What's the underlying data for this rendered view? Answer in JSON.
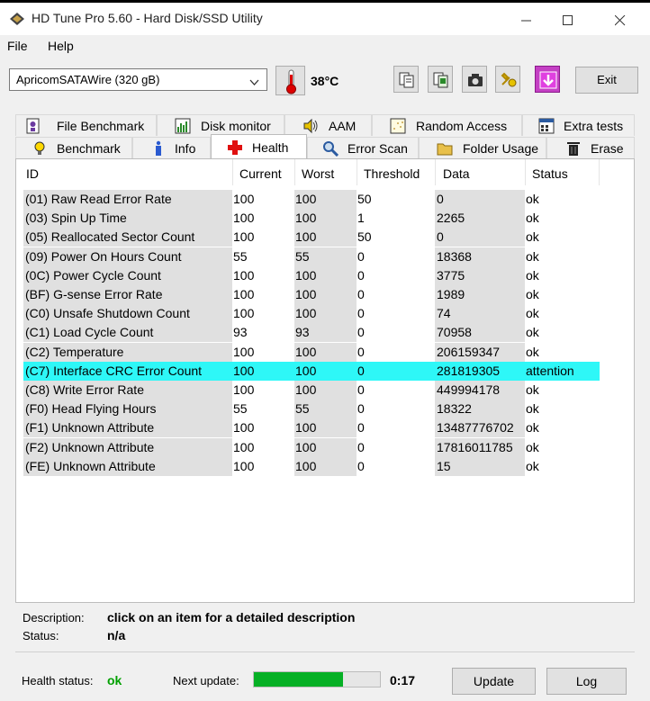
{
  "window": {
    "title": "HD Tune Pro 5.60 - Hard Disk/SSD Utility"
  },
  "menu": {
    "file": "File",
    "help": "Help"
  },
  "toolbar": {
    "drive": "ApricomSATAWire (320 gB)",
    "temperature": "38°C",
    "exit_label": "Exit"
  },
  "tabs_top": [
    {
      "label": "File Benchmark",
      "icon": "file-benchmark-icon"
    },
    {
      "label": "Disk monitor",
      "icon": "disk-monitor-icon"
    },
    {
      "label": "AAM",
      "icon": "speaker-icon"
    },
    {
      "label": "Random Access",
      "icon": "random-access-icon"
    },
    {
      "label": "Extra tests",
      "icon": "extra-tests-icon"
    }
  ],
  "tabs_bottom": [
    {
      "label": "Benchmark",
      "icon": "lightbulb-icon"
    },
    {
      "label": "Info",
      "icon": "info-icon"
    },
    {
      "label": "Health",
      "icon": "health-cross-icon"
    },
    {
      "label": "Error Scan",
      "icon": "magnifier-icon"
    },
    {
      "label": "Folder Usage",
      "icon": "folder-icon"
    },
    {
      "label": "Erase",
      "icon": "trash-icon"
    }
  ],
  "table": {
    "columns": [
      "ID",
      "Current",
      "Worst",
      "Threshold",
      "Data",
      "Status"
    ],
    "rows": [
      [
        "(01) Raw Read Error Rate",
        "100",
        "100",
        "50",
        "0",
        "ok"
      ],
      [
        "(03) Spin Up Time",
        "100",
        "100",
        "1",
        "2265",
        "ok"
      ],
      [
        "(05) Reallocated Sector Count",
        "100",
        "100",
        "50",
        "0",
        "ok"
      ],
      [
        "(09) Power On Hours Count",
        "55",
        "55",
        "0",
        "18368",
        "ok"
      ],
      [
        "(0C) Power Cycle Count",
        "100",
        "100",
        "0",
        "3775",
        "ok"
      ],
      [
        "(BF) G-sense Error Rate",
        "100",
        "100",
        "0",
        "1989",
        "ok"
      ],
      [
        "(C0) Unsafe Shutdown Count",
        "100",
        "100",
        "0",
        "74",
        "ok"
      ],
      [
        "(C1) Load Cycle Count",
        "93",
        "93",
        "0",
        "70958",
        "ok"
      ],
      [
        "(C2) Temperature",
        "100",
        "100",
        "0",
        "206159347",
        "ok"
      ],
      [
        "(C7) Interface CRC Error Count",
        "100",
        "100",
        "0",
        "281819305",
        "attention"
      ],
      [
        "(C8) Write Error Rate",
        "100",
        "100",
        "0",
        "449994178",
        "ok"
      ],
      [
        "(F0) Head Flying Hours",
        "55",
        "55",
        "0",
        "18322",
        "ok"
      ],
      [
        "(F1) Unknown Attribute",
        "100",
        "100",
        "0",
        "13487776702",
        "ok"
      ],
      [
        "(F2) Unknown Attribute",
        "100",
        "100",
        "0",
        "17816011785",
        "ok"
      ],
      [
        "(FE) Unknown Attribute",
        "100",
        "100",
        "0",
        "15",
        "ok"
      ]
    ],
    "highlight_color": "#2ef7f7"
  },
  "description": {
    "desc_label": "Description:",
    "desc_value": "click on an item for a detailed description",
    "status_label": "Status:",
    "status_value": "n/a"
  },
  "footer": {
    "health_label": "Health status:",
    "health_value": "ok",
    "health_color": "#00a000",
    "next_update_label": "Next update:",
    "progress_fraction": 0.71,
    "countdown": "0:17",
    "update_label": "Update",
    "log_label": "Log"
  }
}
